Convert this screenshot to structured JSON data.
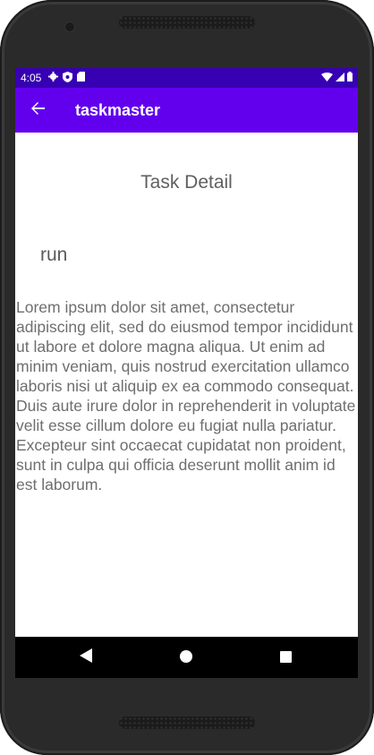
{
  "status_bar": {
    "time": "4:05",
    "left_icons": [
      "settings-icon",
      "shield-icon",
      "sd-card-icon"
    ],
    "right_icons": [
      "wifi-icon",
      "signal-icon",
      "battery-icon"
    ]
  },
  "app_bar": {
    "title": "taskmaster",
    "back_icon": "arrow-back-icon",
    "color": "#6200ee",
    "status_color": "#3700b3"
  },
  "content": {
    "heading": "Task Detail",
    "task_title": "run",
    "task_body": "Lorem ipsum dolor sit amet, consectetur adipiscing elit, sed do eiusmod tempor incididunt ut labore et dolore magna aliqua. Ut enim ad minim veniam, quis nostrud exercitation ullamco laboris nisi ut aliquip ex ea commodo consequat. Duis aute irure dolor in reprehenderit in voluptate velit esse cillum dolore eu fugiat nulla pariatur. Excepteur sint occaecat cupidatat non proident, sunt in culpa qui officia deserunt mollit anim id est laborum."
  },
  "nav_bar": {
    "buttons": [
      "back-triangle-icon",
      "home-circle-icon",
      "recents-square-icon"
    ]
  }
}
